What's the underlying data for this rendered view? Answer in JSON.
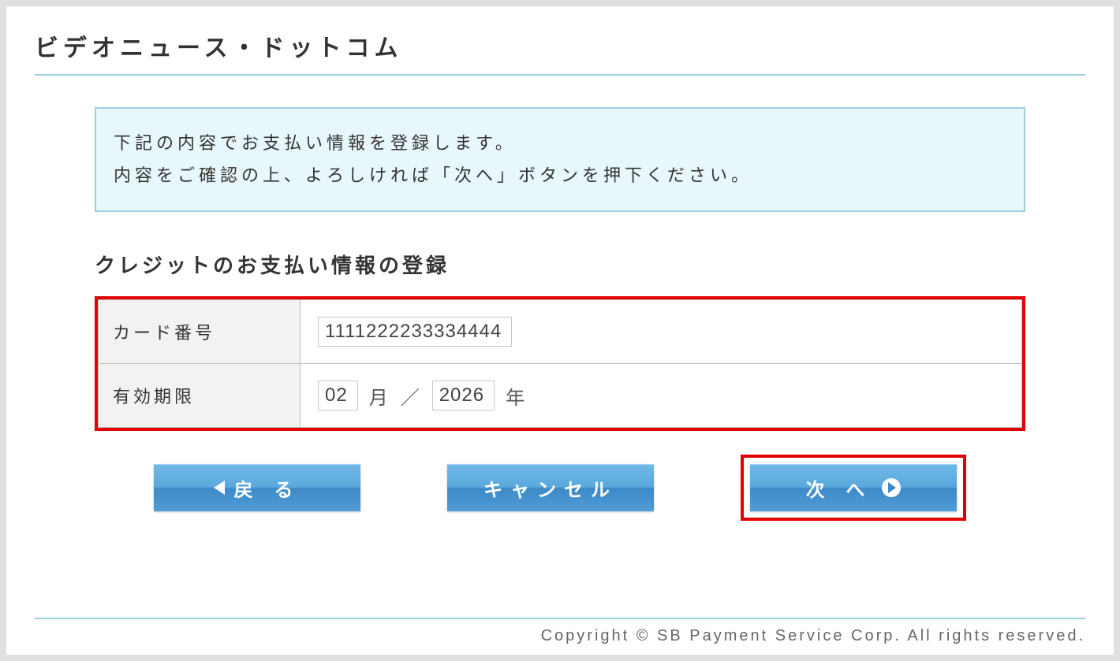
{
  "header": {
    "site_title": "ビデオニュース・ドットコム"
  },
  "info_box": {
    "line1": "下記の内容でお支払い情報を登録します。",
    "line2": "内容をご確認の上、よろしければ「次へ」ボタンを押下ください。"
  },
  "section": {
    "title": "クレジットのお支払い情報の登録"
  },
  "form": {
    "card_number": {
      "label": "カード番号",
      "value": "1111222233334444"
    },
    "expiry": {
      "label": "有効期限",
      "month": "02",
      "month_unit": "月",
      "separator": "／",
      "year": "2026",
      "year_unit": "年"
    }
  },
  "buttons": {
    "back": "戻 る",
    "cancel": "キャンセル",
    "next": "次 へ"
  },
  "footer": {
    "copyright": "Copyright © SB Payment Service Corp. All rights reserved."
  }
}
